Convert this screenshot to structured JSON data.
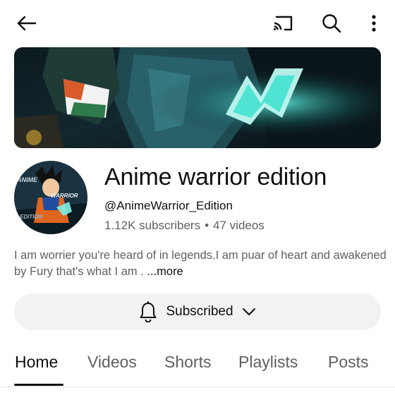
{
  "topbar": {
    "icons": [
      "back-arrow-icon",
      "cast-icon",
      "search-icon",
      "more-vert-icon"
    ]
  },
  "channel": {
    "title": "Anime warrior edition",
    "handle": "@AnimeWarrior_Edition",
    "subscribers": "1.12K subscribers",
    "separator": "•",
    "videos": "47 videos",
    "description": "I am worrier you're heard of in legends.I am puar of heart and awakened by Fury that's what I am . ",
    "more_label": "...more",
    "avatar_text_top": "ANIME",
    "avatar_text_mid": "WARRIOR",
    "avatar_text_bottom": "EDITION"
  },
  "subscribe": {
    "label": "Subscribed",
    "icons": [
      "bell-icon",
      "chevron-down-icon"
    ]
  },
  "tabs": [
    {
      "label": "Home",
      "active": true
    },
    {
      "label": "Videos",
      "active": false
    },
    {
      "label": "Shorts",
      "active": false
    },
    {
      "label": "Playlists",
      "active": false
    },
    {
      "label": "Posts",
      "active": false
    }
  ],
  "colors": {
    "text_primary": "#0f0f0f",
    "text_secondary": "#606060",
    "button_bg": "#f2f2f2",
    "banner_accent": "#34d1c4"
  }
}
